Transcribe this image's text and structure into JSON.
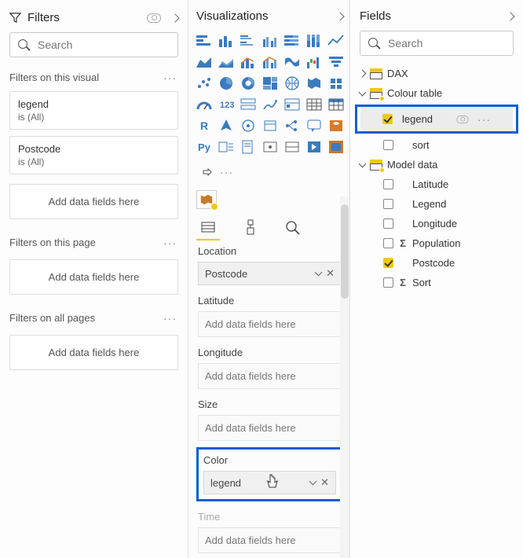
{
  "filters": {
    "title": "Filters",
    "search_placeholder": "Search",
    "sections": {
      "visual": {
        "label": "Filters on this visual"
      },
      "page": {
        "label": "Filters on this page"
      },
      "all": {
        "label": "Filters on all pages"
      }
    },
    "visual_filters": [
      {
        "name": "legend",
        "value": "is (All)"
      },
      {
        "name": "Postcode",
        "value": "is (All)"
      }
    ],
    "add_placeholder": "Add data fields here"
  },
  "viz": {
    "title": "Visualizations",
    "py_label": "Py",
    "r_label": "R",
    "wells": {
      "location": {
        "label": "Location",
        "value": "Postcode"
      },
      "latitude": {
        "label": "Latitude"
      },
      "longitude": {
        "label": "Longitude"
      },
      "size": {
        "label": "Size"
      },
      "color": {
        "label": "Color",
        "value": "legend"
      },
      "time": {
        "label": "Time"
      }
    },
    "empty_placeholder": "Add data fields here"
  },
  "fields": {
    "title": "Fields",
    "search_placeholder": "Search",
    "tables": [
      {
        "name": "DAX",
        "expanded": false
      },
      {
        "name": "Colour table",
        "expanded": true,
        "badge": true,
        "fields": [
          {
            "name": "legend",
            "checked": true,
            "highlighted": true
          },
          {
            "name": "sort",
            "checked": false
          }
        ]
      },
      {
        "name": "Model data",
        "expanded": true,
        "badge": true,
        "fields": [
          {
            "name": "Latitude",
            "checked": false
          },
          {
            "name": "Legend",
            "checked": false
          },
          {
            "name": "Longitude",
            "checked": false
          },
          {
            "name": "Population",
            "checked": false,
            "sigma": true
          },
          {
            "name": "Postcode",
            "checked": true
          },
          {
            "name": "Sort",
            "checked": false,
            "sigma": true
          }
        ]
      }
    ]
  }
}
